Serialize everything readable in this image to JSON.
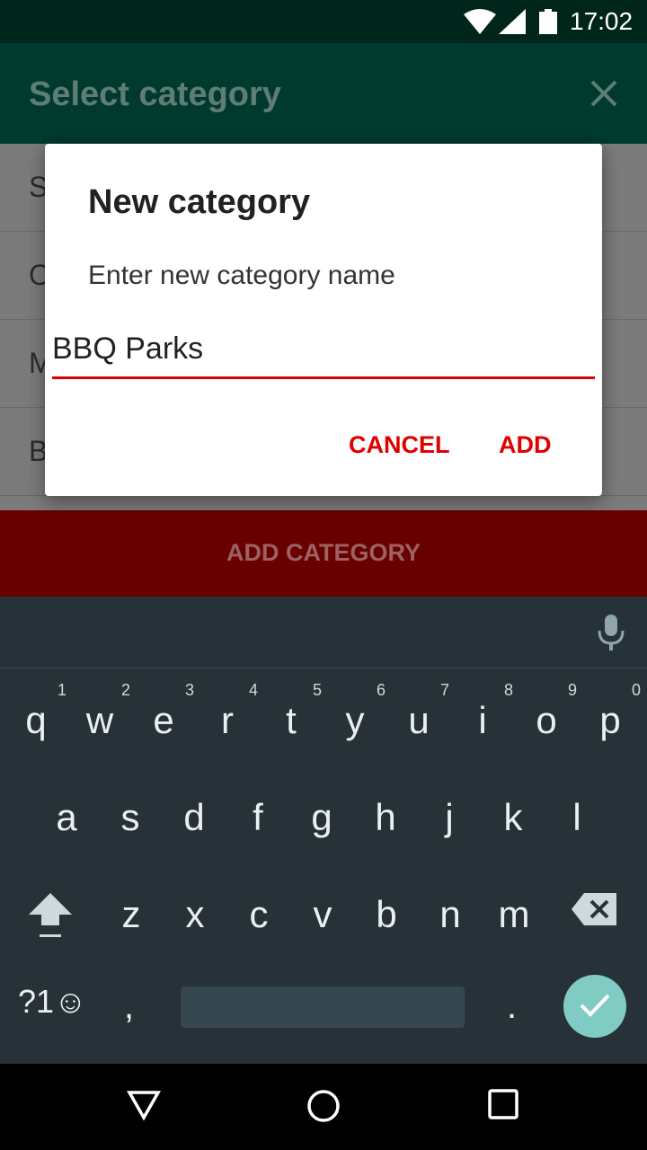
{
  "status_bar": {
    "time": "17:02"
  },
  "app_bar": {
    "title": "Select category"
  },
  "list": {
    "items": [
      "S",
      "O",
      "M",
      "B"
    ]
  },
  "add_bar": {
    "label": "ADD CATEGORY"
  },
  "dialog": {
    "title": "New category",
    "message": "Enter new category name",
    "input_value": "BBQ Parks",
    "cancel_label": "CANCEL",
    "add_label": "ADD"
  },
  "keyboard": {
    "row1": [
      {
        "ch": "q",
        "hint": "1"
      },
      {
        "ch": "w",
        "hint": "2"
      },
      {
        "ch": "e",
        "hint": "3"
      },
      {
        "ch": "r",
        "hint": "4"
      },
      {
        "ch": "t",
        "hint": "5"
      },
      {
        "ch": "y",
        "hint": "6"
      },
      {
        "ch": "u",
        "hint": "7"
      },
      {
        "ch": "i",
        "hint": "8"
      },
      {
        "ch": "o",
        "hint": "9"
      },
      {
        "ch": "p",
        "hint": "0"
      }
    ],
    "row2": [
      "a",
      "s",
      "d",
      "f",
      "g",
      "h",
      "j",
      "k",
      "l"
    ],
    "row3": [
      "z",
      "x",
      "c",
      "v",
      "b",
      "n",
      "m"
    ],
    "symbols_label": "?1☺",
    "comma": ",",
    "period": "."
  },
  "colors": {
    "accent": "#e00000",
    "status_bar": "#00251a",
    "keyboard_bg": "#263238",
    "enter_key": "#80cbc4"
  },
  "icons": {
    "close": "close-icon",
    "mic": "mic-icon",
    "shift": "shift-icon",
    "backspace": "backspace-icon",
    "enter": "check-icon",
    "nav_back": "back-triangle-icon",
    "nav_home": "home-circle-icon",
    "nav_recents": "recents-square-icon"
  }
}
